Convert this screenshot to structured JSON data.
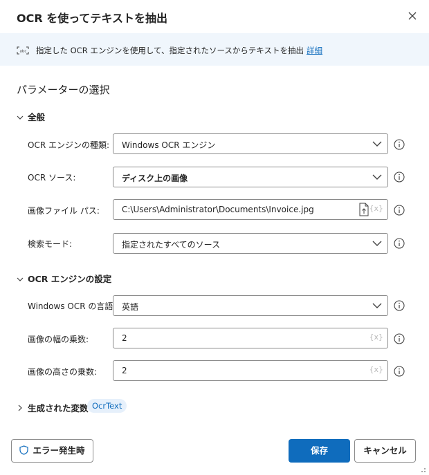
{
  "dialog": {
    "title": "OCR を使ってテキストを抽出",
    "info_text": "指定した OCR エンジンを使用して、指定されたソースからテキストを抽出",
    "info_link": "詳細",
    "params_heading": "パラメーターの選択"
  },
  "general": {
    "section_label": "全般",
    "engine_type": {
      "label": "OCR エンジンの種類:",
      "value": "Windows OCR エンジン"
    },
    "ocr_source": {
      "label": "OCR ソース:",
      "value": "ディスク上の画像"
    },
    "image_path": {
      "label": "画像ファイル パス:",
      "value": "C:\\Users\\Administrator\\Documents\\Invoice.jpg"
    },
    "search_mode": {
      "label": "検索モード:",
      "value": "指定されたすべてのソース"
    }
  },
  "engine_settings": {
    "section_label": "OCR エンジンの設定",
    "language": {
      "label": "Windows OCR の言語:",
      "value": "英語"
    },
    "width_multiplier": {
      "label": "画像の幅の乗数:",
      "value": "2"
    },
    "height_multiplier": {
      "label": "画像の高さの乗数:",
      "value": "2"
    }
  },
  "variables": {
    "section_label": "生成された変数",
    "tag": "OcrText"
  },
  "footer": {
    "on_error_label": "エラー発生時",
    "save_label": "保存",
    "cancel_label": "キャンセル"
  },
  "variable_icon_text": "{x}",
  "colors": {
    "accent": "#0f6cbd",
    "info_bg": "#f0f6fc",
    "tag_bg": "#e6f0fb"
  }
}
